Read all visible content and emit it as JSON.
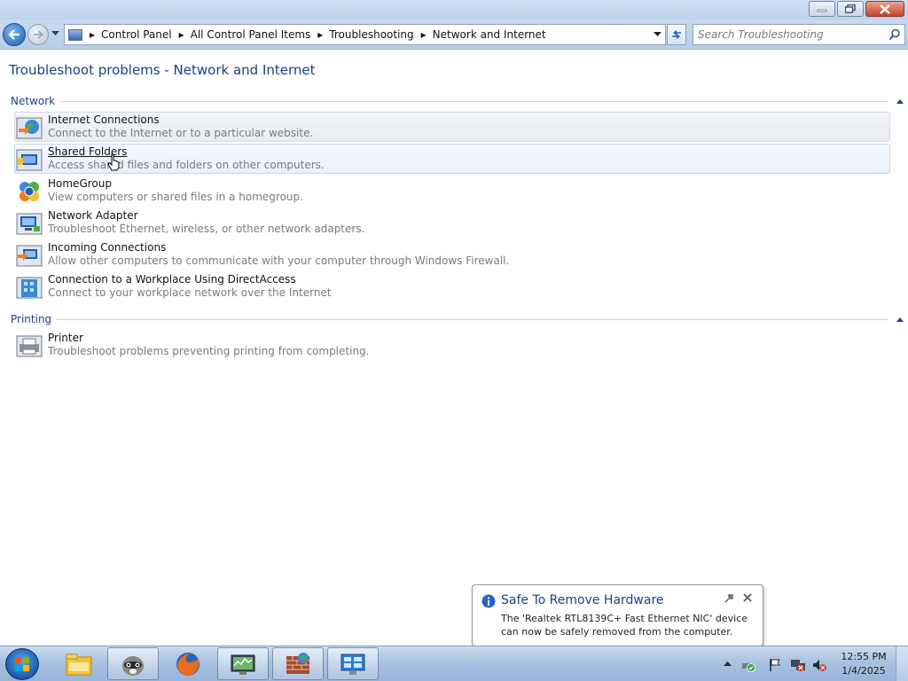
{
  "window": {
    "minimize_label": "minimize",
    "maximize_label": "maximize",
    "close_label": "close"
  },
  "address": {
    "breadcrumbs": [
      "Control Panel",
      "All Control Panel Items",
      "Troubleshooting",
      "Network and Internet"
    ]
  },
  "search": {
    "placeholder": "Search Troubleshooting"
  },
  "page": {
    "title": "Troubleshoot problems - Network and Internet"
  },
  "sections": [
    {
      "label": "Network",
      "items": [
        {
          "name": "Internet Connections",
          "desc": "Connect to the Internet or to a particular website.",
          "icon": "internet-connections-icon"
        },
        {
          "name": "Shared Folders",
          "desc": "Access shared files and folders on other computers.",
          "icon": "shared-folders-icon"
        },
        {
          "name": "HomeGroup",
          "desc": "View computers or shared files in a homegroup.",
          "icon": "homegroup-icon"
        },
        {
          "name": "Network Adapter",
          "desc": "Troubleshoot Ethernet, wireless, or other network adapters.",
          "icon": "network-adapter-icon"
        },
        {
          "name": "Incoming Connections",
          "desc": "Allow other computers to communicate with your computer through Windows Firewall.",
          "icon": "incoming-connections-icon"
        },
        {
          "name": "Connection to a Workplace Using DirectAccess",
          "desc": "Connect to your workplace network over the Internet",
          "icon": "directaccess-icon"
        }
      ]
    },
    {
      "label": "Printing",
      "items": [
        {
          "name": "Printer",
          "desc": "Troubleshoot problems preventing printing from completing.",
          "icon": "printer-icon"
        }
      ]
    }
  ],
  "balloon": {
    "title": "Safe To Remove Hardware",
    "text": "The 'Realtek RTL8139C+ Fast Ethernet NIC' device can now be safely removed from the computer."
  },
  "taskbar": {
    "apps": [
      "file-explorer",
      "raccoon-app",
      "firefox",
      "network-monitor",
      "firewall-app",
      "control-panel"
    ]
  },
  "clock": {
    "time": "12:55 PM",
    "date": "1/4/2025"
  },
  "colors": {
    "title_blue": "#1e3e88",
    "desc_gray": "#7b7b7b"
  }
}
